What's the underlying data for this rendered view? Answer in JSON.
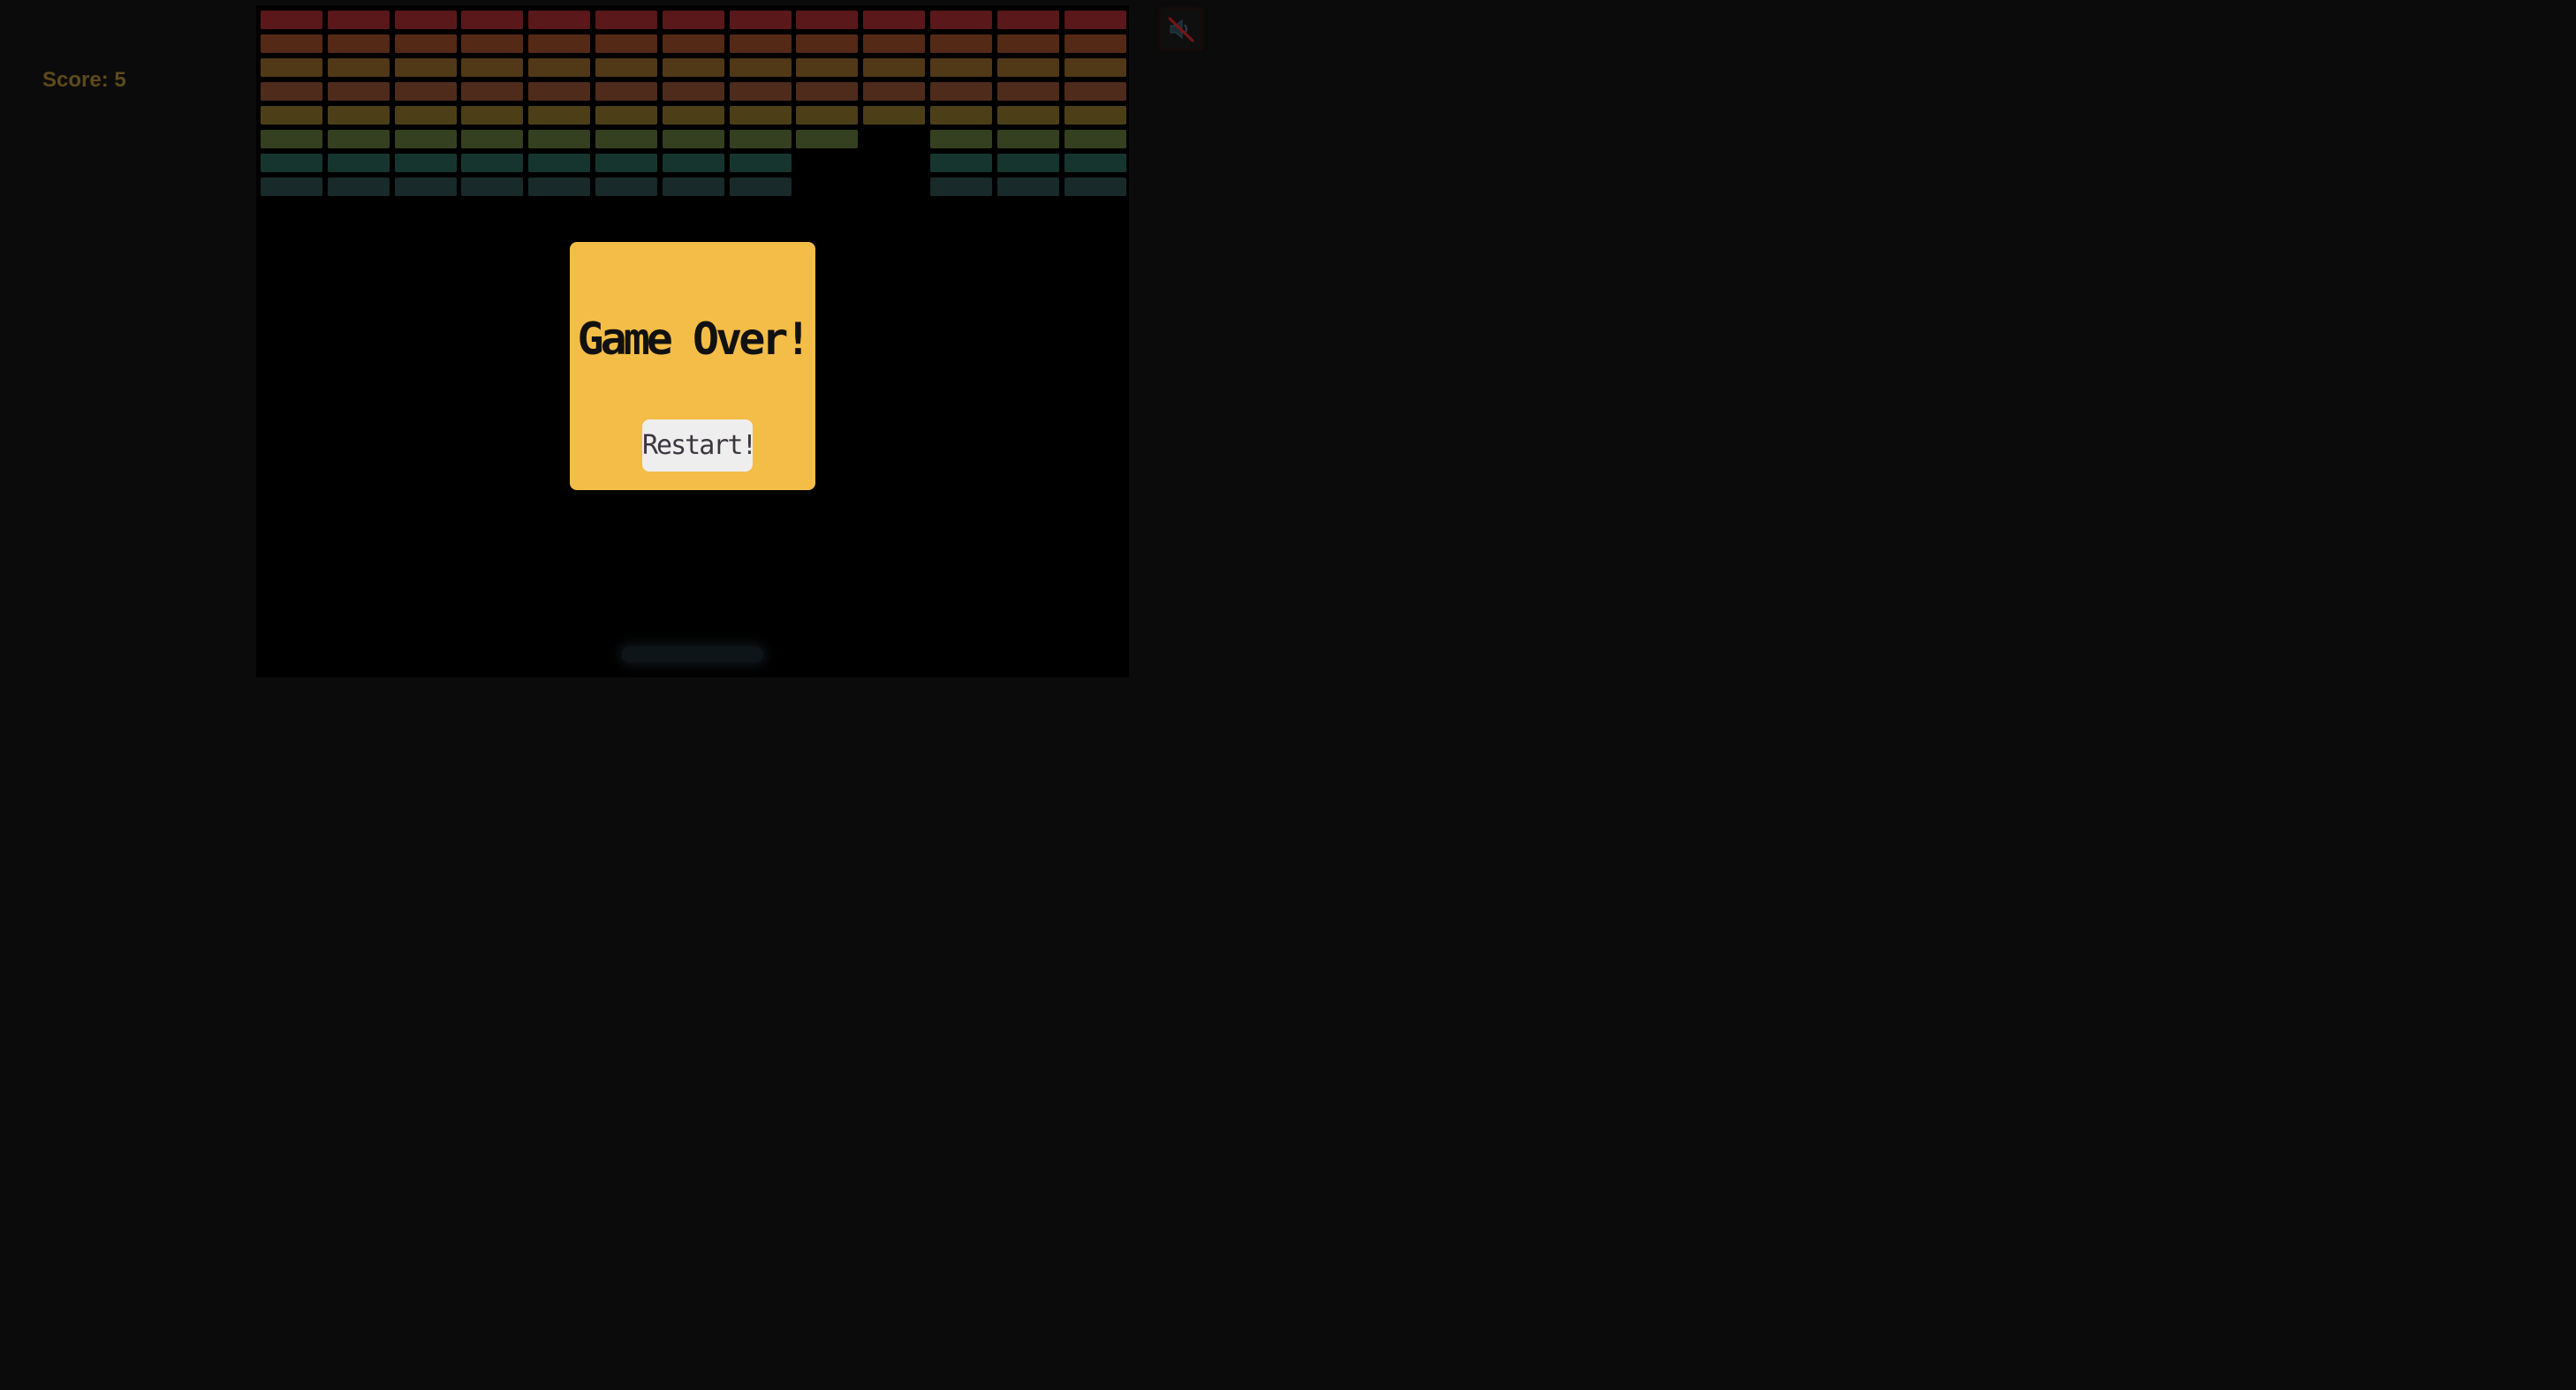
{
  "score": {
    "label": "Score: 5",
    "color": "#5e4a1c"
  },
  "sound_button": {
    "icon": "muted-speaker-icon",
    "state": "muted"
  },
  "board": {
    "columns": 13,
    "rows": 8,
    "row_colors": [
      "#5a181b",
      "#542916",
      "#513816",
      "#4f2b1c",
      "#4c3f18",
      "#34401f",
      "#17352f",
      "#182a29"
    ],
    "missing_bricks": [
      {
        "row": 5,
        "col": 9
      },
      {
        "row": 6,
        "col": 8
      },
      {
        "row": 6,
        "col": 9
      },
      {
        "row": 7,
        "col": 8
      },
      {
        "row": 7,
        "col": 9
      }
    ]
  },
  "paddle": {
    "color": "#0e1518"
  },
  "modal": {
    "title": "Game Over!",
    "restart_label": "Restart!",
    "background": "#f4bd47"
  }
}
